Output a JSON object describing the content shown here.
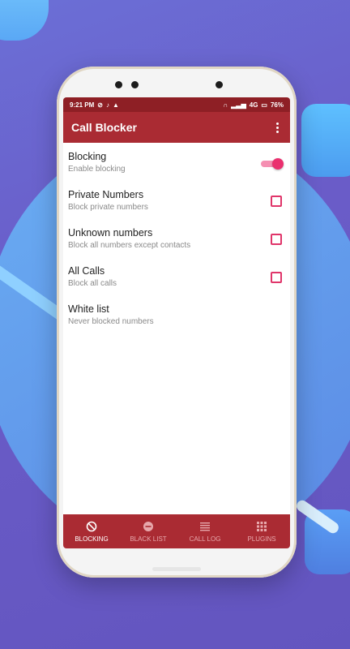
{
  "status": {
    "time": "9:21 PM",
    "network": "4G",
    "battery": "76%"
  },
  "appbar": {
    "title": "Call Blocker"
  },
  "settings": [
    {
      "title": "Blocking",
      "subtitle": "Enable blocking",
      "control": "toggle",
      "checked": true
    },
    {
      "title": "Private Numbers",
      "subtitle": "Block private numbers",
      "control": "checkbox",
      "checked": false
    },
    {
      "title": "Unknown numbers",
      "subtitle": "Block all numbers except contacts",
      "control": "checkbox",
      "checked": false
    },
    {
      "title": "All Calls",
      "subtitle": "Block all calls",
      "control": "checkbox",
      "checked": false
    },
    {
      "title": "White list",
      "subtitle": "Never blocked numbers",
      "control": "none"
    }
  ],
  "bottom_nav": [
    {
      "label": "BLOCKING",
      "icon": "block-icon",
      "active": true
    },
    {
      "label": "BLACK LIST",
      "icon": "minus-circle-icon",
      "active": false
    },
    {
      "label": "CALL LOG",
      "icon": "list-icon",
      "active": false
    },
    {
      "label": "PLUGINS",
      "icon": "grid-icon",
      "active": false
    }
  ],
  "colors": {
    "statusbar": "#8e1f25",
    "appbar": "#aa2b33",
    "accent": "#ea2f6e"
  }
}
